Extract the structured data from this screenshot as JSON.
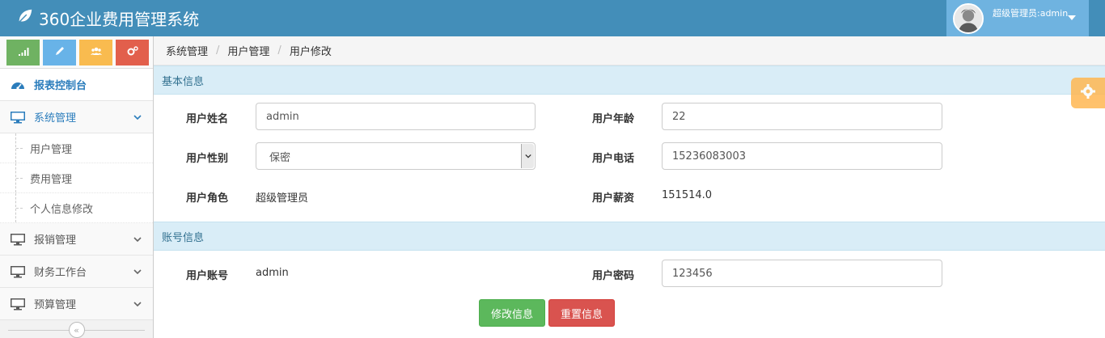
{
  "header": {
    "app_title": "360企业费用管理系统",
    "user_label": "超级管理员:admin",
    "colors": {
      "navbar": "#438eb9",
      "user_box": "#6fb3e0"
    }
  },
  "shortcuts": [
    {
      "icon": "signal-icon",
      "color": "#6fb262"
    },
    {
      "icon": "pencil-icon",
      "color": "#68b3e8"
    },
    {
      "icon": "users-icon",
      "color": "#f9bb4f"
    },
    {
      "icon": "cogs-icon",
      "color": "#e25f4c"
    }
  ],
  "sidebar": {
    "dashboard": "报表控制台",
    "system": "系统管理",
    "system_items": [
      "用户管理",
      "费用管理",
      "个人信息修改"
    ],
    "reimburse": "报销管理",
    "finance": "财务工作台",
    "budget": "预算管理",
    "collapse_symbol": "«"
  },
  "breadcrumb": [
    "系统管理",
    "用户管理",
    "用户修改"
  ],
  "basic": {
    "title": "基本信息",
    "name_label": "用户姓名",
    "name_value": "admin",
    "age_label": "用户年龄",
    "age_value": "22",
    "gender_label": "用户性别",
    "gender_value": "保密",
    "phone_label": "用户电话",
    "phone_value": "15236083003",
    "role_label": "用户角色",
    "role_value": "超级管理员",
    "salary_label": "用户薪资",
    "salary_value": "151514.0"
  },
  "account": {
    "title": "账号信息",
    "account_label": "用户账号",
    "account_value": "admin",
    "password_label": "用户密码",
    "password_value": "123456"
  },
  "actions": {
    "submit": "修改信息",
    "reset": "重置信息"
  }
}
